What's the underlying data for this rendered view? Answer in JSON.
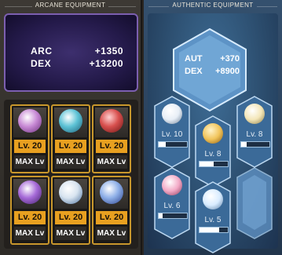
{
  "arcane": {
    "title": "ARCANE EQUIPMENT",
    "stats": [
      {
        "key": "ARC",
        "value": "+1350"
      },
      {
        "key": "DEX",
        "value": "+13200"
      }
    ],
    "slots": [
      {
        "level": "Lv. 20",
        "max": "MAX Lv",
        "icon": "pink-orb-icon",
        "color": "#c98bd6"
      },
      {
        "level": "Lv. 20",
        "max": "MAX Lv",
        "icon": "teal-droplet-icon",
        "color": "#5ec3d6"
      },
      {
        "level": "Lv. 20",
        "max": "MAX Lv",
        "icon": "red-crystal-icon",
        "color": "#d8504e"
      },
      {
        "level": "Lv. 20",
        "max": "MAX Lv",
        "icon": "purple-star-icon",
        "color": "#a66ad8"
      },
      {
        "level": "Lv. 20",
        "max": "MAX Lv",
        "icon": "white-tree-icon",
        "color": "#d8e4f0"
      },
      {
        "level": "Lv. 20",
        "max": "MAX Lv",
        "icon": "blue-swirl-icon",
        "color": "#8fb0e8"
      }
    ]
  },
  "authentic": {
    "title": "AUTHENTIC EQUIPMENT",
    "stats": [
      {
        "key": "AUT",
        "value": "+370"
      },
      {
        "key": "DEX",
        "value": "+8900"
      }
    ],
    "symbols": [
      {
        "level": "Lv. 10",
        "progress": 0.25,
        "icon": "web-ring-icon",
        "color": "#e7eef6"
      },
      {
        "level": "Lv. 8",
        "progress": 0.5,
        "icon": "golden-orb-icon",
        "color": "#f1c45a"
      },
      {
        "level": "Lv. 8",
        "progress": 0.2,
        "icon": "lantern-icon",
        "color": "#f3e6b8"
      },
      {
        "level": "Lv. 6",
        "progress": 0.15,
        "icon": "pink-flower-icon",
        "color": "#f3a9c6"
      },
      {
        "level": "Lv. 5",
        "progress": 0.7,
        "icon": "snowflake-icon",
        "color": "#d9ecff"
      },
      {
        "level": "",
        "progress": 0,
        "icon": "empty-slot-icon",
        "color": "#5f91c3"
      }
    ]
  }
}
